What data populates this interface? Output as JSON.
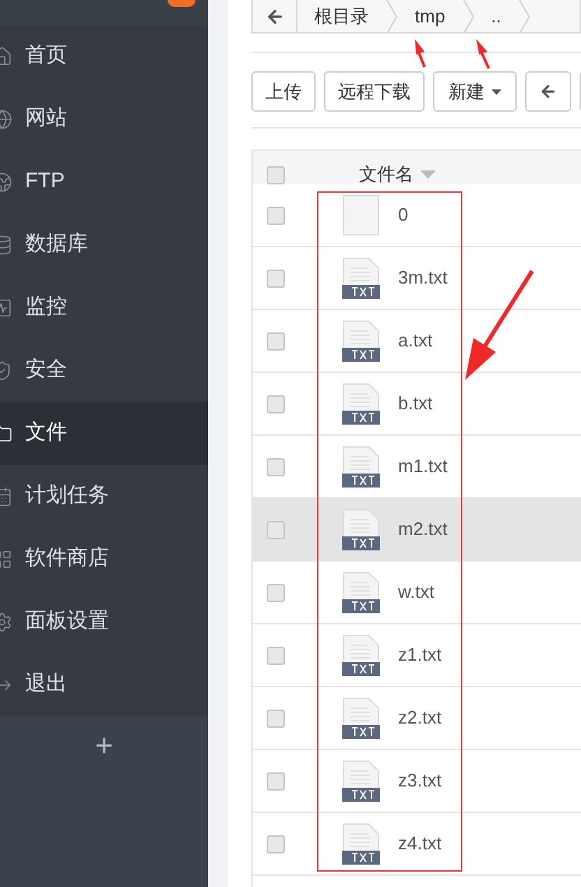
{
  "sidebar": {
    "items": [
      {
        "label": "首页",
        "selected": false
      },
      {
        "label": "网站",
        "selected": false
      },
      {
        "label": "FTP",
        "selected": false
      },
      {
        "label": "数据库",
        "selected": false
      },
      {
        "label": "监控",
        "selected": false
      },
      {
        "label": "安全",
        "selected": false
      },
      {
        "label": "文件",
        "selected": true
      },
      {
        "label": "计划任务",
        "selected": false
      },
      {
        "label": "软件商店",
        "selected": false
      },
      {
        "label": "面板设置",
        "selected": false
      },
      {
        "label": "退出",
        "selected": false
      }
    ],
    "add_button": "+"
  },
  "breadcrumb": [
    "根目录",
    "tmp",
    ".."
  ],
  "toolbar": [
    {
      "label": "上传",
      "kind": "plain"
    },
    {
      "label": "远程下载",
      "kind": "plain"
    },
    {
      "label": "新建",
      "kind": "dropdown"
    },
    {
      "kind": "back"
    }
  ],
  "table": {
    "header": {
      "checked": false,
      "column": "文件名"
    },
    "rows": [
      {
        "name": "0",
        "kind": "file",
        "checked": false,
        "highlighted": false
      },
      {
        "name": "3m.txt",
        "kind": "txt",
        "checked": false,
        "highlighted": false
      },
      {
        "name": "a.txt",
        "kind": "txt",
        "checked": false,
        "highlighted": false
      },
      {
        "name": "b.txt",
        "kind": "txt",
        "checked": false,
        "highlighted": false
      },
      {
        "name": "m1.txt",
        "kind": "txt",
        "checked": false,
        "highlighted": false
      },
      {
        "name": "m2.txt",
        "kind": "txt",
        "checked": false,
        "highlighted": true
      },
      {
        "name": "w.txt",
        "kind": "txt",
        "checked": false,
        "highlighted": false
      },
      {
        "name": "z1.txt",
        "kind": "txt",
        "checked": false,
        "highlighted": false
      },
      {
        "name": "z2.txt",
        "kind": "txt",
        "checked": false,
        "highlighted": false
      },
      {
        "name": "z3.txt",
        "kind": "txt",
        "checked": false,
        "highlighted": false
      },
      {
        "name": "z4.txt",
        "kind": "txt",
        "checked": false,
        "highlighted": false
      }
    ]
  }
}
